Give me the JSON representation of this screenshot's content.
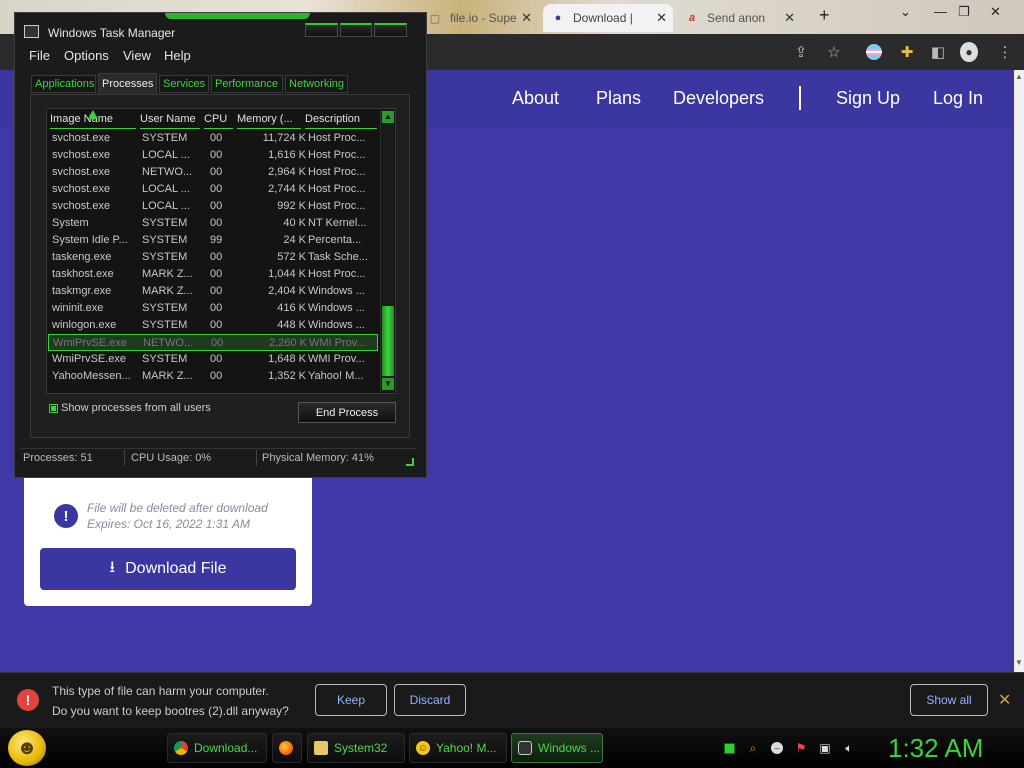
{
  "browser": {
    "tabs": [
      {
        "label": "file.io - Supe",
        "favicon": "file-io-icon",
        "active": false
      },
      {
        "label": "Download |",
        "favicon": "download-page-icon",
        "active": true
      },
      {
        "label": "Send anon",
        "favicon": "anon-icon",
        "active": false
      }
    ],
    "new_tab": "+",
    "controls": {
      "chevron": "⌄",
      "minimize": "—",
      "maximize": "❐",
      "close": "✕"
    },
    "toolbar_icons": [
      "share-icon",
      "star-icon",
      "profile-flag-icon",
      "extensions-icon",
      "sidepanel-icon",
      "account-icon",
      "menu-icon"
    ]
  },
  "page": {
    "nav": {
      "about": "About",
      "plans": "Plans",
      "developers": "Developers",
      "signup": "Sign Up",
      "login": "Log In"
    },
    "card": {
      "notice_line1": "File will be deleted after download",
      "notice_line2": "Expires: Oct 16, 2022 1:31 AM",
      "download_button": "Download File"
    }
  },
  "download_bar": {
    "message_line1": "This type of file can harm your computer.",
    "message_line2": "Do you want to keep bootres (2).dll anyway?",
    "keep": "Keep",
    "discard": "Discard",
    "show_all": "Show all",
    "close": "✕"
  },
  "task_manager": {
    "title": "Windows Task Manager",
    "menu": [
      "File",
      "Options",
      "View",
      "Help"
    ],
    "tabs": [
      "Applications",
      "Processes",
      "Services",
      "Performance",
      "Networking"
    ],
    "active_tab": "Processes",
    "columns": [
      "Image Name",
      "User Name",
      "CPU",
      "Memory (...",
      "Description"
    ],
    "rows": [
      [
        "svchost.exe",
        "SYSTEM",
        "00",
        "11,724 K",
        "Host Proc..."
      ],
      [
        "svchost.exe",
        "LOCAL ...",
        "00",
        "1,616 K",
        "Host Proc..."
      ],
      [
        "svchost.exe",
        "NETWO...",
        "00",
        "2,964 K",
        "Host Proc..."
      ],
      [
        "svchost.exe",
        "LOCAL ...",
        "00",
        "2,744 K",
        "Host Proc..."
      ],
      [
        "svchost.exe",
        "LOCAL ...",
        "00",
        "992 K",
        "Host Proc..."
      ],
      [
        "System",
        "SYSTEM",
        "00",
        "40 K",
        "NT Kernel..."
      ],
      [
        "System Idle P...",
        "SYSTEM",
        "99",
        "24 K",
        "Percenta..."
      ],
      [
        "taskeng.exe",
        "SYSTEM",
        "00",
        "572 K",
        "Task Sche..."
      ],
      [
        "taskhost.exe",
        "MARK Z...",
        "00",
        "1,044 K",
        "Host Proc..."
      ],
      [
        "taskmgr.exe",
        "MARK Z...",
        "00",
        "2,404 K",
        "Windows ..."
      ],
      [
        "wininit.exe",
        "SYSTEM",
        "00",
        "416 K",
        "Windows ..."
      ],
      [
        "winlogon.exe",
        "SYSTEM",
        "00",
        "448 K",
        "Windows ..."
      ],
      [
        "WmiPrvSE.exe",
        "NETWO...",
        "00",
        "2,260 K",
        "WMI Prov..."
      ],
      [
        "WmiPrvSE.exe",
        "SYSTEM",
        "00",
        "1,648 K",
        "WMI Prov..."
      ],
      [
        "YahooMessen...",
        "MARK Z...",
        "00",
        "1,352 K",
        "Yahoo! M..."
      ]
    ],
    "selected_row": 12,
    "show_all_users": "Show processes from all users",
    "show_all_users_checked": true,
    "end_process": "End Process",
    "status": {
      "processes": "Processes: 51",
      "cpu": "CPU Usage: 0%",
      "memory": "Physical Memory: 41%"
    }
  },
  "taskbar": {
    "items": [
      {
        "label": "Download...",
        "icon": "chrome-icon",
        "active": false
      },
      {
        "label": "",
        "icon": "firefox-icon",
        "active": false
      },
      {
        "label": "System32",
        "icon": "folder-icon",
        "active": false
      },
      {
        "label": "Yahoo! M...",
        "icon": "yahoo-messenger-icon",
        "active": false
      },
      {
        "label": "Windows ...",
        "icon": "task-manager-icon",
        "active": true
      }
    ],
    "tray_icons": [
      "green-square-icon",
      "search-icon",
      "messenger-icon",
      "flag-icon",
      "network-icon",
      "volume-icon"
    ],
    "clock": "1:32 AM"
  },
  "colors": {
    "accent_green": "#3cd23c",
    "page_purple": "#3b36a0",
    "button_blue": "#8fb4ff",
    "error_red": "#e0443c"
  }
}
